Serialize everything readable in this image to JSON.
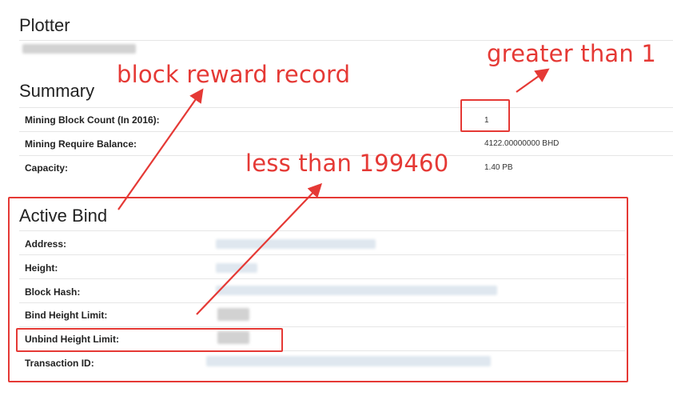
{
  "plotter": {
    "title": "Plotter"
  },
  "summary": {
    "title": "Summary",
    "rows": [
      {
        "label": "Mining Block Count (In 2016):",
        "value": "1"
      },
      {
        "label": "Mining Require Balance:",
        "value": "4122.00000000 BHD"
      },
      {
        "label": "Capacity:",
        "value": "1.40 PB"
      }
    ]
  },
  "active_bind": {
    "title": "Active Bind",
    "rows": [
      {
        "label": "Address:"
      },
      {
        "label": "Height:"
      },
      {
        "label": "Block Hash:"
      },
      {
        "label": "Bind Height Limit:"
      },
      {
        "label": "Unbind Height Limit:"
      },
      {
        "label": "Transaction ID:"
      }
    ]
  },
  "annotations": {
    "greater": "greater than 1",
    "block_reward": "block reward record",
    "less": "less than 199460",
    "color": "#e53935"
  }
}
